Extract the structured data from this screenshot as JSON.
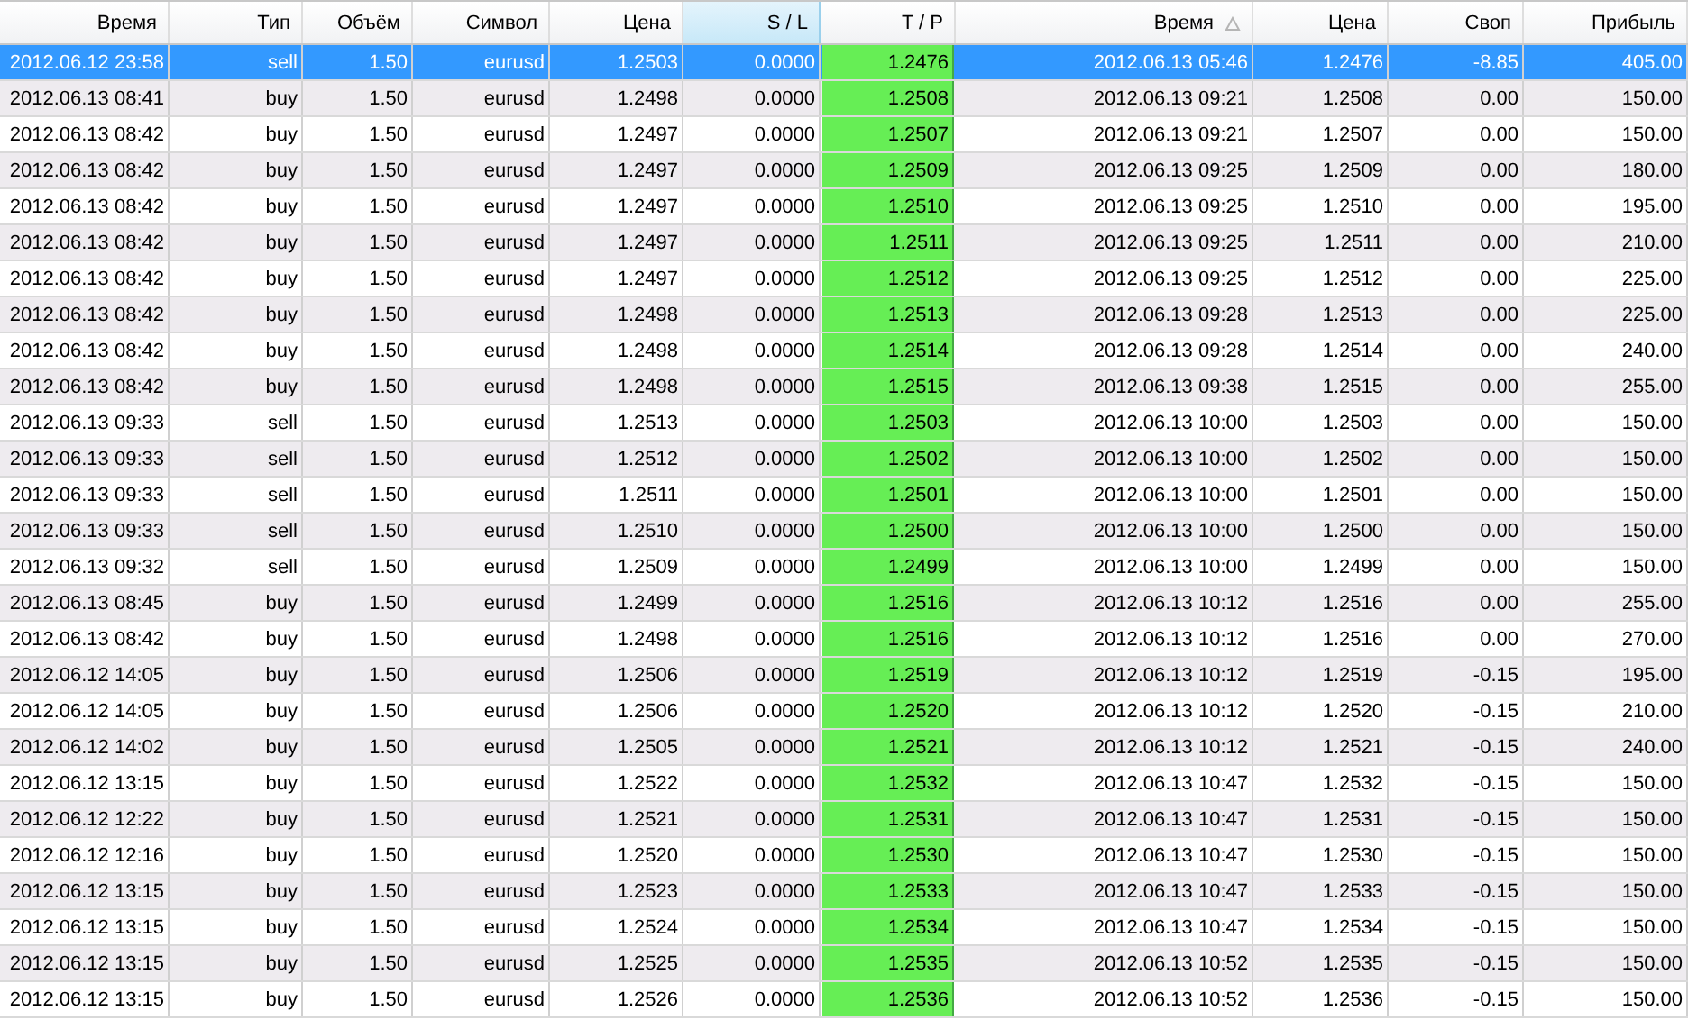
{
  "table": {
    "columns": [
      {
        "label": "Время",
        "kind": "plain",
        "selected": false,
        "sorted": false
      },
      {
        "label": "Тип",
        "kind": "plain",
        "selected": false,
        "sorted": false
      },
      {
        "label": "Объём",
        "kind": "plain",
        "selected": false,
        "sorted": false
      },
      {
        "label": "Символ",
        "kind": "plain",
        "selected": false,
        "sorted": false
      },
      {
        "label": "Цена",
        "kind": "plain",
        "selected": false,
        "sorted": false
      },
      {
        "label": "S / L",
        "kind": "plain",
        "selected": true,
        "sorted": false
      },
      {
        "label": "T / P",
        "kind": "target",
        "selected": false,
        "sorted": false
      },
      {
        "label": "Время",
        "kind": "plain",
        "selected": false,
        "sorted": true
      },
      {
        "label": "Цена",
        "kind": "plain",
        "selected": false,
        "sorted": false
      },
      {
        "label": "Своп",
        "kind": "plain",
        "selected": false,
        "sorted": false
      },
      {
        "label": "Прибыль",
        "kind": "plain",
        "selected": false,
        "sorted": false
      }
    ],
    "rows": [
      {
        "selected": true,
        "cells": [
          "2012.06.12 23:58",
          "sell",
          "1.50",
          "eurusd",
          "1.2503",
          "0.0000",
          "1.2476",
          "2012.06.13 05:46",
          "1.2476",
          "-8.85",
          "405.00"
        ]
      },
      {
        "selected": false,
        "cells": [
          "2012.06.13 08:41",
          "buy",
          "1.50",
          "eurusd",
          "1.2498",
          "0.0000",
          "1.2508",
          "2012.06.13 09:21",
          "1.2508",
          "0.00",
          "150.00"
        ]
      },
      {
        "selected": false,
        "cells": [
          "2012.06.13 08:42",
          "buy",
          "1.50",
          "eurusd",
          "1.2497",
          "0.0000",
          "1.2507",
          "2012.06.13 09:21",
          "1.2507",
          "0.00",
          "150.00"
        ]
      },
      {
        "selected": false,
        "cells": [
          "2012.06.13 08:42",
          "buy",
          "1.50",
          "eurusd",
          "1.2497",
          "0.0000",
          "1.2509",
          "2012.06.13 09:25",
          "1.2509",
          "0.00",
          "180.00"
        ]
      },
      {
        "selected": false,
        "cells": [
          "2012.06.13 08:42",
          "buy",
          "1.50",
          "eurusd",
          "1.2497",
          "0.0000",
          "1.2510",
          "2012.06.13 09:25",
          "1.2510",
          "0.00",
          "195.00"
        ]
      },
      {
        "selected": false,
        "cells": [
          "2012.06.13 08:42",
          "buy",
          "1.50",
          "eurusd",
          "1.2497",
          "0.0000",
          "1.2511",
          "2012.06.13 09:25",
          "1.2511",
          "0.00",
          "210.00"
        ]
      },
      {
        "selected": false,
        "cells": [
          "2012.06.13 08:42",
          "buy",
          "1.50",
          "eurusd",
          "1.2497",
          "0.0000",
          "1.2512",
          "2012.06.13 09:25",
          "1.2512",
          "0.00",
          "225.00"
        ]
      },
      {
        "selected": false,
        "cells": [
          "2012.06.13 08:42",
          "buy",
          "1.50",
          "eurusd",
          "1.2498",
          "0.0000",
          "1.2513",
          "2012.06.13 09:28",
          "1.2513",
          "0.00",
          "225.00"
        ]
      },
      {
        "selected": false,
        "cells": [
          "2012.06.13 08:42",
          "buy",
          "1.50",
          "eurusd",
          "1.2498",
          "0.0000",
          "1.2514",
          "2012.06.13 09:28",
          "1.2514",
          "0.00",
          "240.00"
        ]
      },
      {
        "selected": false,
        "cells": [
          "2012.06.13 08:42",
          "buy",
          "1.50",
          "eurusd",
          "1.2498",
          "0.0000",
          "1.2515",
          "2012.06.13 09:38",
          "1.2515",
          "0.00",
          "255.00"
        ]
      },
      {
        "selected": false,
        "cells": [
          "2012.06.13 09:33",
          "sell",
          "1.50",
          "eurusd",
          "1.2513",
          "0.0000",
          "1.2503",
          "2012.06.13 10:00",
          "1.2503",
          "0.00",
          "150.00"
        ]
      },
      {
        "selected": false,
        "cells": [
          "2012.06.13 09:33",
          "sell",
          "1.50",
          "eurusd",
          "1.2512",
          "0.0000",
          "1.2502",
          "2012.06.13 10:00",
          "1.2502",
          "0.00",
          "150.00"
        ]
      },
      {
        "selected": false,
        "cells": [
          "2012.06.13 09:33",
          "sell",
          "1.50",
          "eurusd",
          "1.2511",
          "0.0000",
          "1.2501",
          "2012.06.13 10:00",
          "1.2501",
          "0.00",
          "150.00"
        ]
      },
      {
        "selected": false,
        "cells": [
          "2012.06.13 09:33",
          "sell",
          "1.50",
          "eurusd",
          "1.2510",
          "0.0000",
          "1.2500",
          "2012.06.13 10:00",
          "1.2500",
          "0.00",
          "150.00"
        ]
      },
      {
        "selected": false,
        "cells": [
          "2012.06.13 09:32",
          "sell",
          "1.50",
          "eurusd",
          "1.2509",
          "0.0000",
          "1.2499",
          "2012.06.13 10:00",
          "1.2499",
          "0.00",
          "150.00"
        ]
      },
      {
        "selected": false,
        "cells": [
          "2012.06.13 08:45",
          "buy",
          "1.50",
          "eurusd",
          "1.2499",
          "0.0000",
          "1.2516",
          "2012.06.13 10:12",
          "1.2516",
          "0.00",
          "255.00"
        ]
      },
      {
        "selected": false,
        "cells": [
          "2012.06.13 08:42",
          "buy",
          "1.50",
          "eurusd",
          "1.2498",
          "0.0000",
          "1.2516",
          "2012.06.13 10:12",
          "1.2516",
          "0.00",
          "270.00"
        ]
      },
      {
        "selected": false,
        "cells": [
          "2012.06.12 14:05",
          "buy",
          "1.50",
          "eurusd",
          "1.2506",
          "0.0000",
          "1.2519",
          "2012.06.13 10:12",
          "1.2519",
          "-0.15",
          "195.00"
        ]
      },
      {
        "selected": false,
        "cells": [
          "2012.06.12 14:05",
          "buy",
          "1.50",
          "eurusd",
          "1.2506",
          "0.0000",
          "1.2520",
          "2012.06.13 10:12",
          "1.2520",
          "-0.15",
          "210.00"
        ]
      },
      {
        "selected": false,
        "cells": [
          "2012.06.12 14:02",
          "buy",
          "1.50",
          "eurusd",
          "1.2505",
          "0.0000",
          "1.2521",
          "2012.06.13 10:12",
          "1.2521",
          "-0.15",
          "240.00"
        ]
      },
      {
        "selected": false,
        "cells": [
          "2012.06.12 13:15",
          "buy",
          "1.50",
          "eurusd",
          "1.2522",
          "0.0000",
          "1.2532",
          "2012.06.13 10:47",
          "1.2532",
          "-0.15",
          "150.00"
        ]
      },
      {
        "selected": false,
        "cells": [
          "2012.06.12 12:22",
          "buy",
          "1.50",
          "eurusd",
          "1.2521",
          "0.0000",
          "1.2531",
          "2012.06.13 10:47",
          "1.2531",
          "-0.15",
          "150.00"
        ]
      },
      {
        "selected": false,
        "cells": [
          "2012.06.12 12:16",
          "buy",
          "1.50",
          "eurusd",
          "1.2520",
          "0.0000",
          "1.2530",
          "2012.06.13 10:47",
          "1.2530",
          "-0.15",
          "150.00"
        ]
      },
      {
        "selected": false,
        "cells": [
          "2012.06.12 13:15",
          "buy",
          "1.50",
          "eurusd",
          "1.2523",
          "0.0000",
          "1.2533",
          "2012.06.13 10:47",
          "1.2533",
          "-0.15",
          "150.00"
        ]
      },
      {
        "selected": false,
        "cells": [
          "2012.06.12 13:15",
          "buy",
          "1.50",
          "eurusd",
          "1.2524",
          "0.0000",
          "1.2534",
          "2012.06.13 10:47",
          "1.2534",
          "-0.15",
          "150.00"
        ]
      },
      {
        "selected": false,
        "cells": [
          "2012.06.12 13:15",
          "buy",
          "1.50",
          "eurusd",
          "1.2525",
          "0.0000",
          "1.2535",
          "2012.06.13 10:52",
          "1.2535",
          "-0.15",
          "150.00"
        ]
      },
      {
        "selected": false,
        "cells": [
          "2012.06.12 13:15",
          "buy",
          "1.50",
          "eurusd",
          "1.2526",
          "0.0000",
          "1.2536",
          "2012.06.13 10:52",
          "1.2536",
          "-0.15",
          "150.00"
        ]
      }
    ]
  }
}
